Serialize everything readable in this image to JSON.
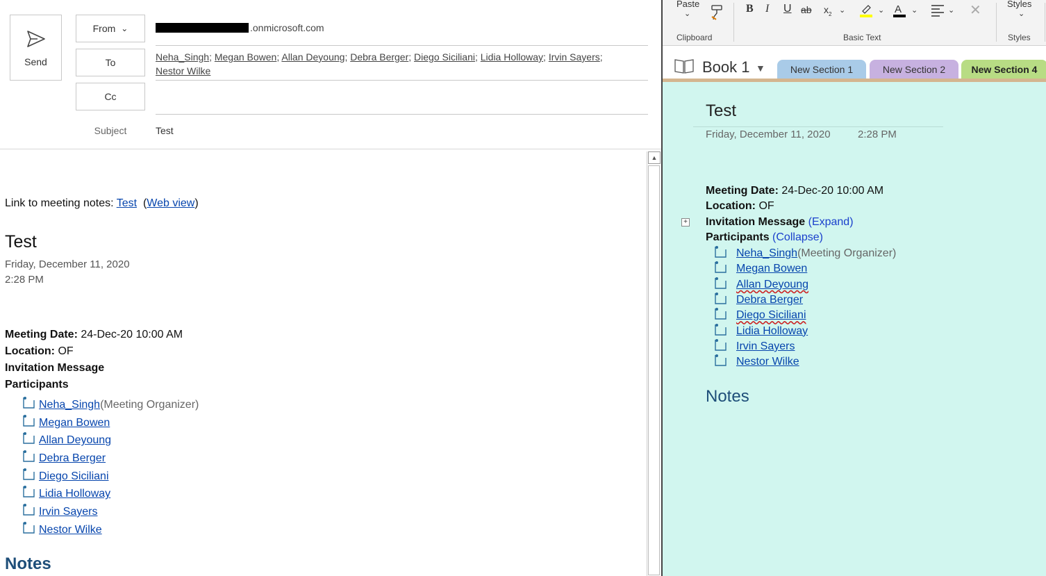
{
  "compose": {
    "send_label": "Send",
    "from_label": "From",
    "to_label": "To",
    "cc_label": "Cc",
    "from_value": ".onmicrosoft.com",
    "to_recipients": [
      "Neha_Singh",
      "Megan Bowen",
      "Allan Deyoung",
      "Debra Berger",
      "Diego Siciliani",
      "Lidia Holloway",
      "Irvin Sayers",
      "Nestor Wilke"
    ],
    "subject_label": "Subject",
    "subject_value": "Test"
  },
  "email_body": {
    "link_prefix": "Link to meeting notes: ",
    "link_text": "Test",
    "web_view_open": "(",
    "web_view_text": "Web view",
    "web_view_close": ")",
    "title": "Test",
    "date": "Friday, December 11, 2020",
    "time": "2:28 PM",
    "meeting_date_label": "Meeting Date:",
    "meeting_date_value": " 24-Dec-20 10:00 AM",
    "location_label": "Location:",
    "location_value": " OF",
    "invitation_label": "Invitation Message",
    "participants_label": "Participants",
    "organizer_note": "(Meeting Organizer)",
    "notes_heading": "Notes"
  },
  "participants": [
    "Neha_Singh ",
    "Megan Bowen",
    "Allan Deyoung",
    "Debra Berger",
    "Diego Siciliani",
    "Lidia Holloway",
    "Irvin Sayers",
    "Nestor Wilke"
  ],
  "onenote": {
    "ribbon": {
      "paste_label": "Paste",
      "clipboard_group": "Clipboard",
      "basic_text_group": "Basic Text",
      "styles_label": "Styles",
      "styles_group": "Styles",
      "highlight_color": "#ffff00",
      "font_color": "#000000"
    },
    "notebook_name": "Book 1",
    "sections": [
      {
        "label": "New Section 1",
        "color": "#a9cbe8"
      },
      {
        "label": "New Section 2",
        "color": "#c7b1e0"
      },
      {
        "label": "New Section 4",
        "color": "#b8dc84",
        "active": true
      }
    ],
    "page": {
      "title": "Test",
      "date": "Friday, December 11, 2020",
      "time": "2:28 PM",
      "meeting_date_label": "Meeting Date:",
      "meeting_date_value": " 24-Dec-20 10:00 AM",
      "location_label": "Location:",
      "location_value": " OF",
      "invitation_label": "Invitation Message",
      "expand_text": "(Expand)",
      "participants_label": "Participants",
      "collapse_text": "(Collapse)",
      "organizer_note": "(Meeting Organizer)",
      "notes_heading": "Notes",
      "page_background": "#d1f6ef"
    }
  }
}
